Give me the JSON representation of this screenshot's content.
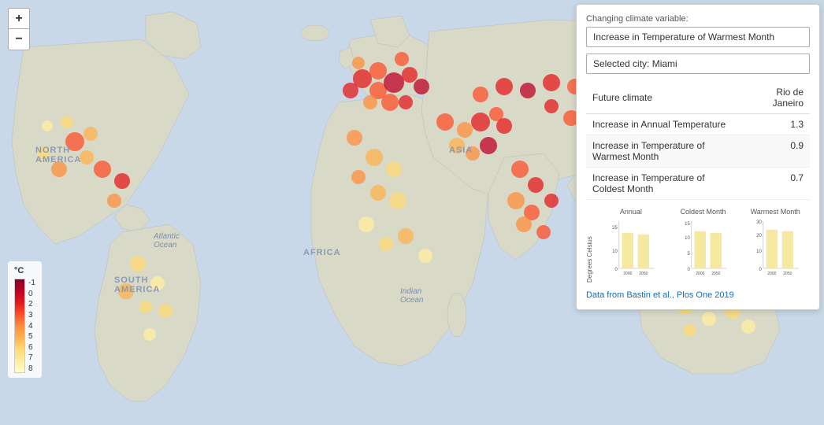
{
  "map": {
    "continents": [
      {
        "label": "NORTH AMERICA",
        "top": "185",
        "left": "55"
      },
      {
        "label": "SOUTH AMERICA",
        "top": "345",
        "left": "150"
      },
      {
        "label": "ASIA",
        "top": "190",
        "left": "575"
      },
      {
        "label": "AFRICA",
        "top": "320",
        "left": "390"
      },
      {
        "label": "Atlantic Ocean",
        "top": "300",
        "left": "200"
      },
      {
        "label": "Indian Ocean",
        "top": "370",
        "left": "510"
      }
    ],
    "zoom_plus": "+",
    "zoom_minus": "−"
  },
  "legend": {
    "unit": "°C",
    "labels": [
      "--1",
      "-0",
      "-2",
      "-3",
      "-4",
      "-5",
      "-6",
      "-7",
      "-8"
    ]
  },
  "panel": {
    "climate_variable_label": "Changing climate variable:",
    "dropdown_value": "Increase in Temperature of Warmest Month",
    "dropdown_options": [
      "Increase in Temperature of Warmest Month",
      "Increase in Temperature of Coldest Month",
      "Increase in Annual Temperature"
    ],
    "selected_city_label": "Selected city: Miami",
    "table": {
      "col1_header": "Future climate",
      "col2_header": "Rio de Janeiro",
      "rows": [
        {
          "label": "Increase in Annual Temperature",
          "value": "1.3"
        },
        {
          "label": "Increase in Temperature of Warmest Month",
          "value": "0.9"
        },
        {
          "label": "Increase in Temperature of Coldest Month",
          "value": "0.7"
        }
      ]
    },
    "charts": {
      "y_axis_label": "Degrees Celsius",
      "items": [
        {
          "title": "Annual",
          "y_max": 25,
          "y_ticks": [
            0,
            10,
            25
          ],
          "x_labels": [
            "2000",
            "2050"
          ],
          "bar_color": "#f5e9a0"
        },
        {
          "title": "Coldest Month",
          "y_max": 15,
          "y_ticks": [
            0,
            5,
            10,
            15
          ],
          "x_labels": [
            "2000",
            "2050"
          ],
          "bar_color": "#f5e9a0"
        },
        {
          "title": "Warmest Month",
          "y_max": 30,
          "y_ticks": [
            0,
            10,
            20,
            30
          ],
          "x_labels": [
            "2000",
            "2050"
          ],
          "bar_color": "#f5e9a0"
        }
      ]
    },
    "citation_text": "Data from Bastin et al., Plos One 2019",
    "citation_url": "#"
  }
}
